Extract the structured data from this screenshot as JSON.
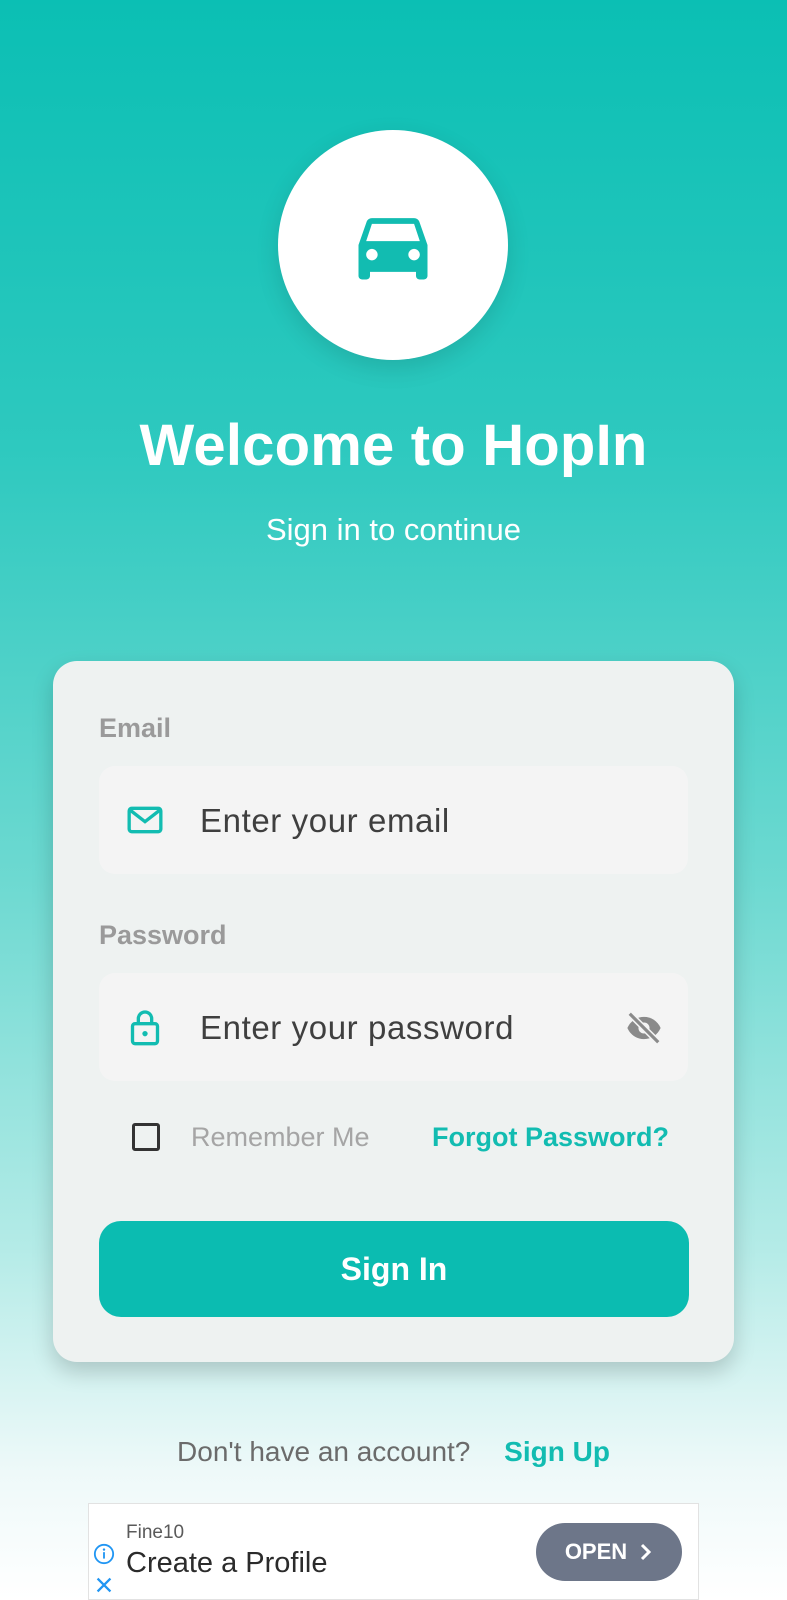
{
  "brand": {
    "logo_icon": "car-icon",
    "title": "Welcome to HopIn",
    "subtitle": "Sign in to continue"
  },
  "form": {
    "email": {
      "label": "Email",
      "placeholder": "Enter your email",
      "icon": "mail-icon"
    },
    "password": {
      "label": "Password",
      "placeholder": "Enter your password",
      "icon": "lock-icon",
      "toggle_icon": "eye-off-icon"
    },
    "remember_me": {
      "label": "Remember Me",
      "checked": false
    },
    "forgot_password": "Forgot Password?",
    "submit_label": "Sign In"
  },
  "footer": {
    "prompt": "Don't have an account?",
    "signup_link": "Sign Up"
  },
  "ad_banner": {
    "advertiser": "Fine10",
    "headline": "Create a Profile",
    "cta": "OPEN",
    "icons": [
      "info-icon",
      "close-icon",
      "chevron-right-icon"
    ]
  },
  "colors": {
    "accent": "#0bbcb1",
    "card_background": "#eef2f1",
    "label_gray": "#9a9a9a",
    "ad_button": "#6d7689"
  }
}
